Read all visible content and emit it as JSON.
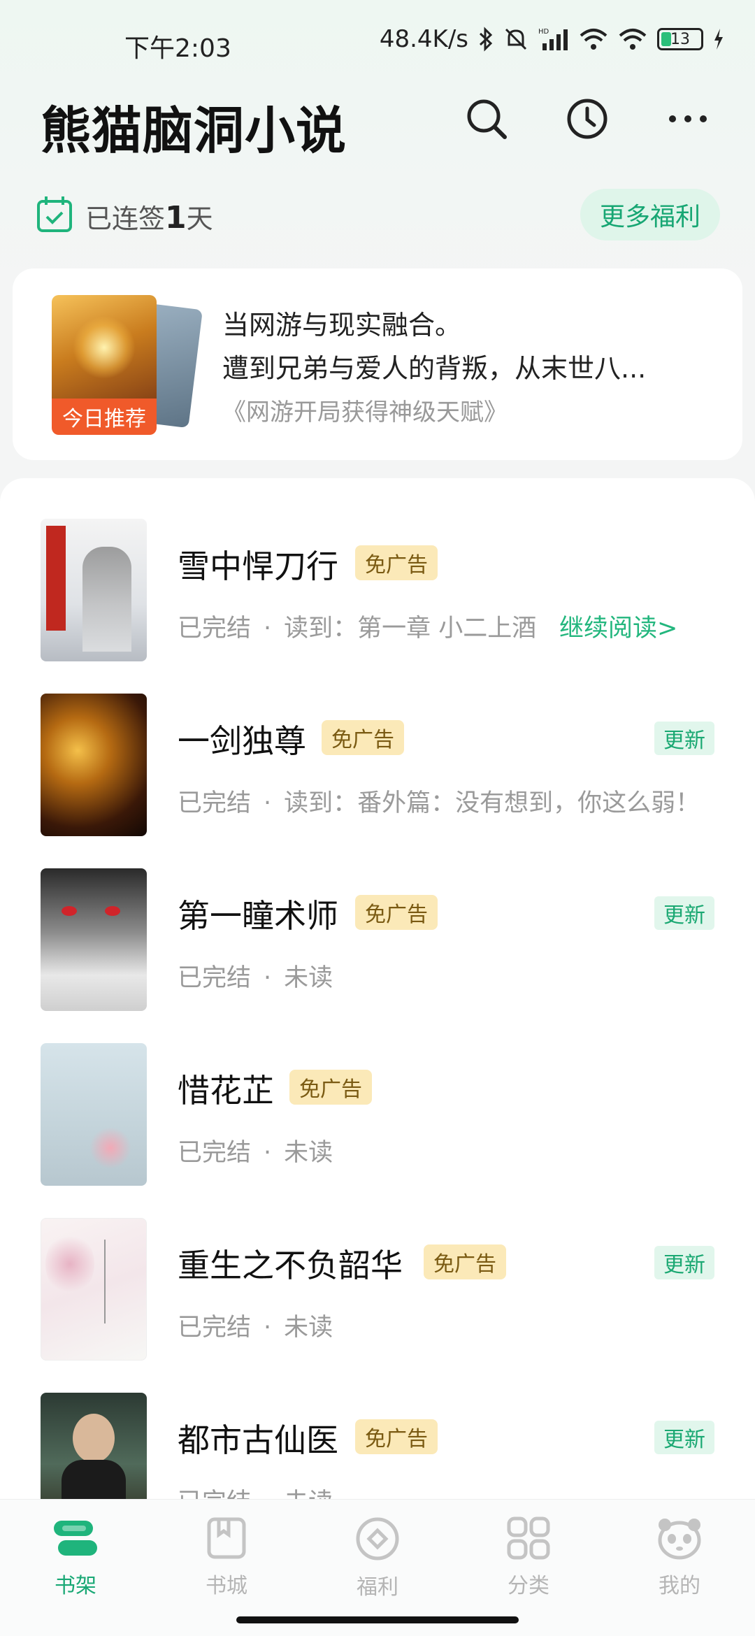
{
  "status_bar": {
    "time": "下午2:03",
    "speed": "48.4K/s",
    "battery": "13"
  },
  "header": {
    "app_title": "熊猫脑洞小说"
  },
  "signin": {
    "prefix": "已连签",
    "days": "1",
    "suffix": "天",
    "more_welfare": "更多福利"
  },
  "recommend": {
    "badge": "今日推荐",
    "line1": "当网游与现实融合。",
    "line2": "遭到兄弟与爱人的背叛，从末世八...",
    "book_title": "《网游开局获得神级天赋》"
  },
  "books": [
    {
      "title": "雪中悍刀行",
      "tag": "免广告",
      "status": "已完结",
      "progress": "读到：第一章 小二上酒",
      "action": "继续阅读>",
      "update": ""
    },
    {
      "title": "一剑独尊",
      "tag": "免广告",
      "status": "已完结",
      "progress": "读到：番外篇：没有想到，你这么弱！",
      "action": "",
      "update": "更新"
    },
    {
      "title": "第一瞳术师",
      "tag": "免广告",
      "status": "已完结",
      "progress": "未读",
      "action": "",
      "update": "更新"
    },
    {
      "title": "惜花芷",
      "tag": "免广告",
      "status": "已完结",
      "progress": "未读",
      "action": "",
      "update": ""
    },
    {
      "title": "重生之不负韶华",
      "tag": "免广告",
      "status": "已完结",
      "progress": "未读",
      "action": "",
      "update": "更新"
    },
    {
      "title": "都市古仙医",
      "tag": "免广告",
      "status": "已完结",
      "progress": "未读",
      "action": "",
      "update": "更新"
    }
  ],
  "nav": [
    {
      "label": "书架",
      "icon": "bookshelf-icon"
    },
    {
      "label": "书城",
      "icon": "bookstore-icon"
    },
    {
      "label": "福利",
      "icon": "welfare-icon"
    },
    {
      "label": "分类",
      "icon": "category-icon"
    },
    {
      "label": "我的",
      "icon": "panda-profile-icon"
    }
  ],
  "colors": {
    "accent": "#19a875",
    "ad_tag_bg": "#fbe9b8",
    "update_bg": "#e1f6ec",
    "badge_orange": "#f05a2a"
  }
}
